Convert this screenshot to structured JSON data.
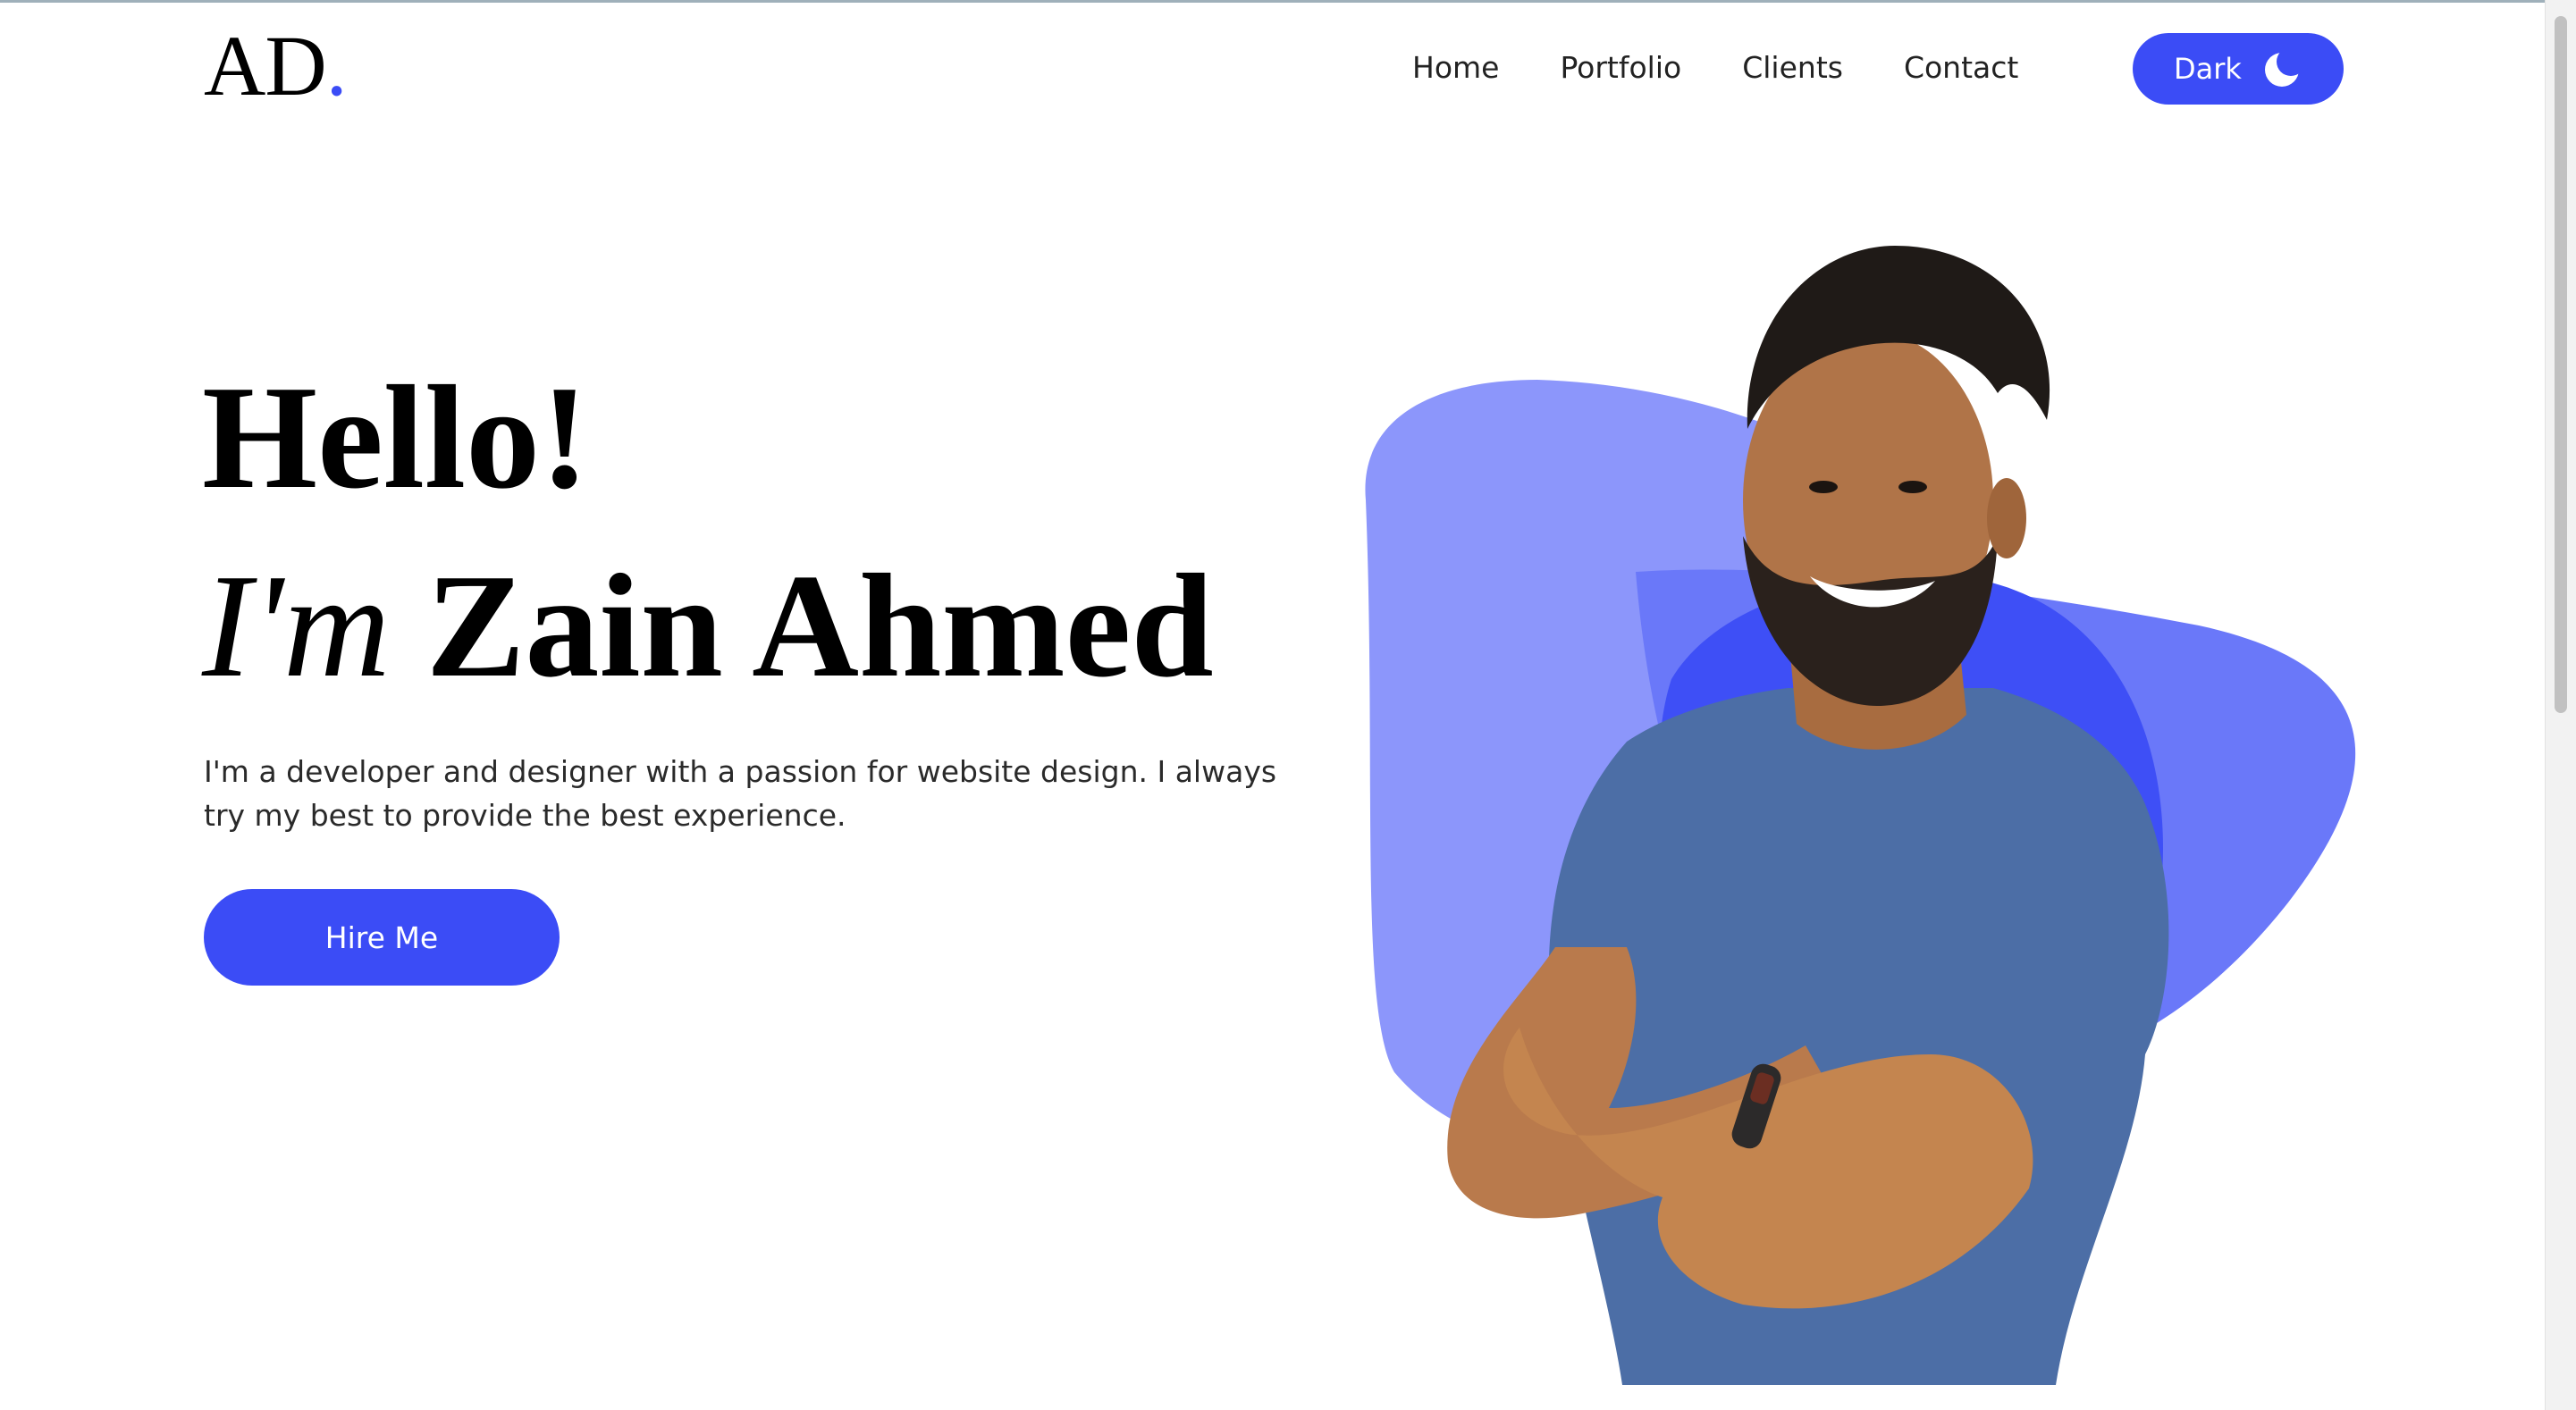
{
  "brand": {
    "logo_text": "AD",
    "logo_dot": ".",
    "accent": "#3b4cf6"
  },
  "nav": {
    "items": [
      {
        "label": "Home"
      },
      {
        "label": "Portfolio"
      },
      {
        "label": "Clients"
      },
      {
        "label": "Contact"
      }
    ]
  },
  "theme_toggle": {
    "label": "Dark",
    "icon": "moon-icon"
  },
  "hero": {
    "greeting": "Hello!",
    "im": "I'm",
    "name": "Zain Ahmed",
    "intro": "I'm a developer and designer with a passion for website design. I always try my best to provide the best experience.",
    "cta_label": "Hire Me"
  },
  "colors": {
    "blob_light": "#8c96fb",
    "blob_mid": "#6573f8",
    "blob_dark": "#3e4ff6",
    "shirt": "#4c6ea6",
    "skin": "#b07448",
    "hair": "#1f1a17"
  }
}
